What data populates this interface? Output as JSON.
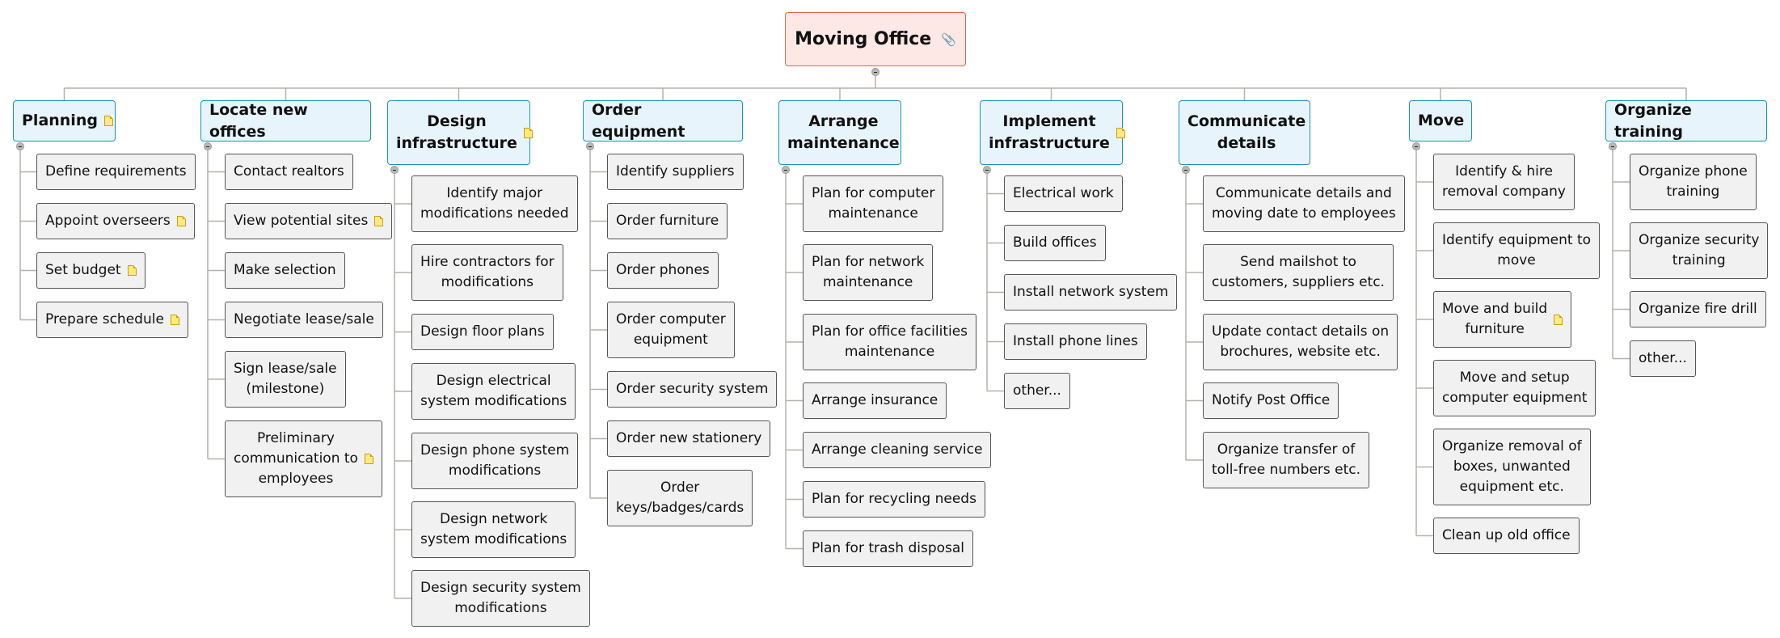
{
  "root": {
    "label": "Moving Office",
    "icon": "paperclip-icon"
  },
  "colors": {
    "root_fill": "#fde8e5",
    "root_border": "#e2643f",
    "main_fill": "#e8f4fc",
    "main_border": "#1a95b3",
    "sub_fill": "#f1f1f1",
    "line": "#b5b1aa"
  },
  "branches": [
    {
      "label": "Planning",
      "note": true,
      "children": [
        {
          "label": "Define requirements"
        },
        {
          "label": "Appoint overseers",
          "note": true
        },
        {
          "label": "Set budget",
          "note": true
        },
        {
          "label": "Prepare schedule",
          "note": true
        }
      ]
    },
    {
      "label": "Locate new offices",
      "children": [
        {
          "label": "Contact realtors"
        },
        {
          "label": "View potential sites",
          "note": true
        },
        {
          "label": "Make selection"
        },
        {
          "label": "Negotiate lease/sale"
        },
        {
          "label": "Sign lease/sale\n(milestone)"
        },
        {
          "label": "Preliminary\ncommunication to\nemployees",
          "note": true
        }
      ]
    },
    {
      "label": "Design\ninfrastructure",
      "note": true,
      "children": [
        {
          "label": "Identify major\nmodifications needed"
        },
        {
          "label": "Hire contractors for\nmodifications"
        },
        {
          "label": "Design floor plans"
        },
        {
          "label": "Design electrical\nsystem modifications"
        },
        {
          "label": "Design phone system\nmodifications"
        },
        {
          "label": "Design network\nsystem modifications"
        },
        {
          "label": "Design security system\nmodifications"
        }
      ]
    },
    {
      "label": "Order equipment",
      "children": [
        {
          "label": "Identify suppliers"
        },
        {
          "label": "Order furniture"
        },
        {
          "label": "Order phones"
        },
        {
          "label": "Order computer\nequipment"
        },
        {
          "label": "Order security system"
        },
        {
          "label": "Order new stationery"
        },
        {
          "label": "Order\nkeys/badges/cards"
        }
      ]
    },
    {
      "label": "Arrange\nmaintenance",
      "children": [
        {
          "label": "Plan for computer\nmaintenance"
        },
        {
          "label": "Plan for network\nmaintenance"
        },
        {
          "label": "Plan for office facilities\nmaintenance"
        },
        {
          "label": "Arrange insurance"
        },
        {
          "label": "Arrange cleaning service"
        },
        {
          "label": "Plan for recycling needs"
        },
        {
          "label": "Plan for trash disposal"
        }
      ]
    },
    {
      "label": "Implement\ninfrastructure",
      "note": true,
      "children": [
        {
          "label": "Electrical work"
        },
        {
          "label": "Build offices"
        },
        {
          "label": "Install network system"
        },
        {
          "label": "Install phone lines"
        },
        {
          "label": "other..."
        }
      ]
    },
    {
      "label": "Communicate\ndetails",
      "children": [
        {
          "label": "Communicate details and\nmoving date to employees"
        },
        {
          "label": "Send mailshot to\ncustomers, suppliers etc."
        },
        {
          "label": "Update contact details on\nbrochures, website etc."
        },
        {
          "label": "Notify Post Office"
        },
        {
          "label": "Organize transfer of\ntoll-free numbers etc."
        }
      ]
    },
    {
      "label": "Move",
      "children": [
        {
          "label": "Identify & hire\nremoval company"
        },
        {
          "label": "Identify equipment to\nmove"
        },
        {
          "label": "Move and build\nfurniture",
          "note": true
        },
        {
          "label": "Move and setup\ncomputer equipment"
        },
        {
          "label": "Organize removal of\nboxes, unwanted\nequipment etc."
        },
        {
          "label": "Clean up old office"
        }
      ]
    },
    {
      "label": "Organize training",
      "children": [
        {
          "label": "Organize phone\ntraining"
        },
        {
          "label": "Organize security\ntraining"
        },
        {
          "label": "Organize fire drill"
        },
        {
          "label": "other..."
        }
      ]
    }
  ]
}
